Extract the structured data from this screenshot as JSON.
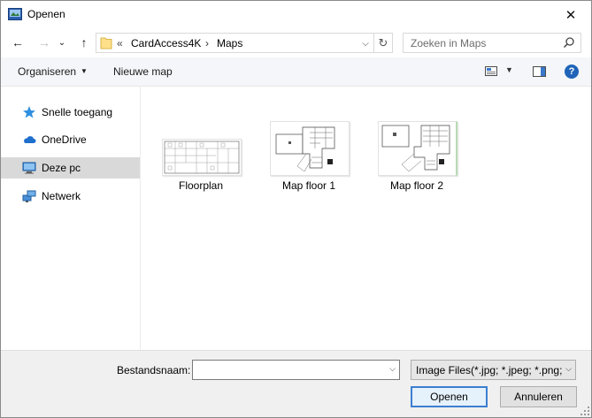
{
  "window": {
    "title": "Openen",
    "close_glyph": "✕"
  },
  "nav": {
    "back_glyph": "←",
    "forward_glyph": "→",
    "recent_glyph": "⌄",
    "up_glyph": "↑",
    "breadcrumb_lead": "«",
    "breadcrumbs": [
      "CardAccess4K",
      "Maps"
    ],
    "separator": "›",
    "address_dropdown_glyph": "⌵",
    "refresh_glyph": "↻",
    "search_placeholder": "Zoeken in Maps"
  },
  "commandbar": {
    "organize_label": "Organiseren",
    "new_folder_label": "Nieuwe map",
    "caret_glyph": "▼",
    "help_glyph": "?"
  },
  "sidebar": {
    "items": [
      {
        "label": "Snelle toegang",
        "icon": "star-icon",
        "selected": false
      },
      {
        "label": "OneDrive",
        "icon": "cloud-icon",
        "selected": false
      },
      {
        "label": "Deze pc",
        "icon": "computer-icon",
        "selected": true
      },
      {
        "label": "Netwerk",
        "icon": "network-icon",
        "selected": false
      }
    ]
  },
  "files": [
    {
      "name": "Floorplan",
      "icon": "image-thumbnail-icon"
    },
    {
      "name": "Map floor 1",
      "icon": "image-thumbnail-icon"
    },
    {
      "name": "Map floor 2",
      "icon": "image-thumbnail-icon"
    }
  ],
  "footer": {
    "filename_label": "Bestandsnaam:",
    "filename_value": "",
    "filter_value": "Image Files(*.jpg; *.jpeg; *.png;",
    "dropdown_glyph": "⌵",
    "open_label": "Openen",
    "cancel_label": "Annuleren"
  },
  "colors": {
    "accent": "#3c7fd1",
    "selected_bg": "#d9d9d9",
    "footer_bg": "#f0f0f0",
    "help_blue": "#1f64b8"
  }
}
